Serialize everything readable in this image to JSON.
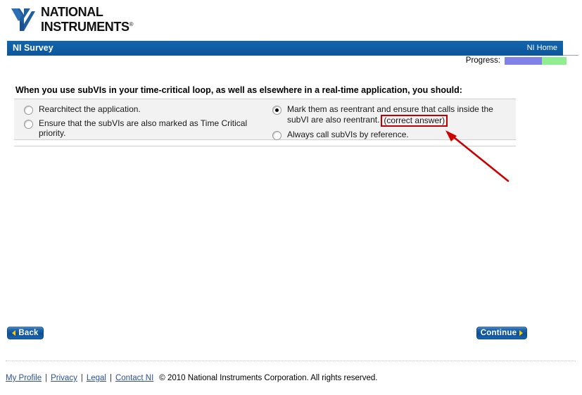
{
  "brand": {
    "name_line1": "NATIONAL",
    "name_line2": "INSTRUMENTS",
    "trademark": "®",
    "logo_icon": "ni-eagle-logo",
    "logo_color": "#1f5fa0"
  },
  "header": {
    "title": "NI Survey",
    "home_link": "NI Home",
    "bar_color": "#0f5fa6"
  },
  "progress": {
    "label": "Progress:",
    "filled_percent": 60,
    "remaining_percent": 40,
    "filled_color": "#8182e8",
    "remaining_color": "#90ee90"
  },
  "question": {
    "text": "When you use subVIs in your time-critical loop, as well as elsewhere in a real-time application, you should:",
    "options_left": [
      {
        "label": "Rearchitect the application.",
        "selected": false
      },
      {
        "label": "Ensure that the subVIs are also marked as Time Critical priority.",
        "selected": false
      }
    ],
    "options_right": [
      {
        "label": "Mark them as reentrant and ensure that calls inside the subVI are also reentrant.",
        "selected": true,
        "annotation": "(correct answer)"
      },
      {
        "label": "Always call subVIs by reference.",
        "selected": false
      }
    ]
  },
  "annotation": {
    "arrow_color": "#cc0000",
    "box_color": "#c00000",
    "arrow_name": "red-pointer-arrow"
  },
  "buttons": {
    "back": "Back",
    "continue": "Continue",
    "back_icon": "arrow-left-icon",
    "continue_icon": "arrow-right-icon"
  },
  "footer": {
    "links": [
      "My Profile",
      "Privacy",
      "Legal",
      "Contact NI"
    ],
    "separator": "|",
    "copyright": "© 2010 National Instruments Corporation. All rights reserved."
  }
}
